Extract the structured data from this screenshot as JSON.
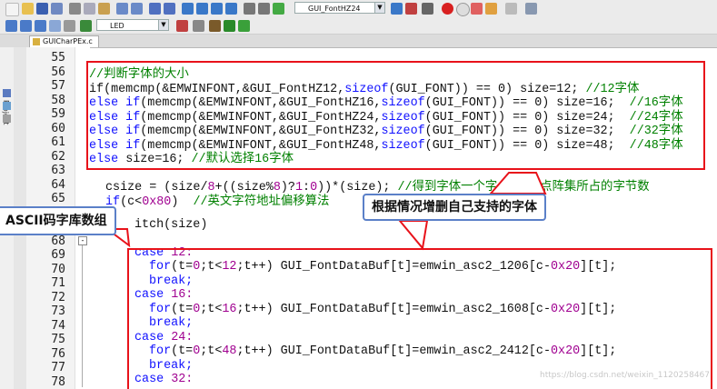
{
  "toolbar": {
    "target_combo": "GUI_FontHZ24",
    "target_select": "LED"
  },
  "editor": {
    "tab_label": "GUICharPEx.c",
    "sidebar_label": "Project",
    "line_numbers": [
      "55",
      "56",
      "57",
      "58",
      "59",
      "60",
      "61",
      "62",
      "63",
      "64",
      "65",
      "66",
      "67",
      "68",
      "69",
      "70",
      "71",
      "72",
      "73",
      "74",
      "75",
      "76",
      "77",
      "78"
    ]
  },
  "code": {
    "l56": "//判断字体的大小",
    "l57a": "if(memcmp(&EMWINFONT,&GUI_FontHZ12,",
    "l57b": "sizeof",
    "l57c": "(GUI_FONT)) == 0) size=12; ",
    "l57d": "//12字体",
    "l58a": "else if",
    "l58b": "(memcmp(&EMWINFONT,&GUI_FontHZ16,",
    "l58c": "sizeof",
    "l58d": "(GUI_FONT)) == 0) size=16;  ",
    "l58e": "//16字体",
    "l59a": "else if",
    "l59b": "(memcmp(&EMWINFONT,&GUI_FontHZ24,",
    "l59c": "sizeof",
    "l59d": "(GUI_FONT)) == 0) size=24;  ",
    "l59e": "//24字体",
    "l60a": "else if",
    "l60b": "(memcmp(&EMWINFONT,&GUI_FontHZ32,",
    "l60c": "sizeof",
    "l60d": "(GUI_FONT)) == 0) size=32;  ",
    "l60e": "//32字体",
    "l61a": "else if",
    "l61b": "(memcmp(&EMWINFONT,&GUI_FontHZ48,",
    "l61c": "sizeof",
    "l61d": "(GUI_FONT)) == 0) size=48;  ",
    "l61e": "//48字体",
    "l62a": "else ",
    "l62b": "size=16; ",
    "l62c": "//默认选择16字体",
    "l64a": "csize = (size/",
    "l64b": "8",
    "l64c": "+((size%",
    "l64d": "8",
    "l64e": ")?",
    "l64f": "1",
    "l64g": ":",
    "l64h": "0",
    "l64i": "))*(size); ",
    "l64j": "//得到字体一个字",
    "l64k": "对应点阵集所占的字节数",
    "l65a": "if",
    "l65b": "(c<",
    "l65c": "0x80",
    "l65d": ")  ",
    "l65e": "//英文字符地址偏移算法",
    "l67": "itch(size)",
    "case_kw": "case",
    "break_kw": "break;",
    "for_kw": "for",
    "case_12": "12:",
    "case_16": "16:",
    "case_24": "24:",
    "case_32": "32:",
    "for12a": "(t=",
    "for12b": "0",
    "for12c": ";t<",
    "for12d": "12",
    "for12e": ";t++) GUI_FontDataBuf[t]=emwin_asc2_1206[c-",
    "for_hex": "0x20",
    "for_tail": "][t];",
    "for16d": "16",
    "for16e": ";t++) GUI_FontDataBuf[t]=emwin_asc2_1608[c-",
    "for24d": "48",
    "for24e": ";t++) GUI_FontDataBuf[t]=emwin_asc2_2412[c-"
  },
  "annotations": {
    "callout_right": "根据情况增删自己支持的字体",
    "callout_left": "ASCII码字库数组"
  },
  "watermark": "https://blog.csdn.net/weixin_1120258467",
  "colors": {
    "highlight": "#e8121a",
    "keyword": "#1010ff",
    "comment": "#008000",
    "number": "#a00090",
    "callout_border": "#5b80c8"
  }
}
